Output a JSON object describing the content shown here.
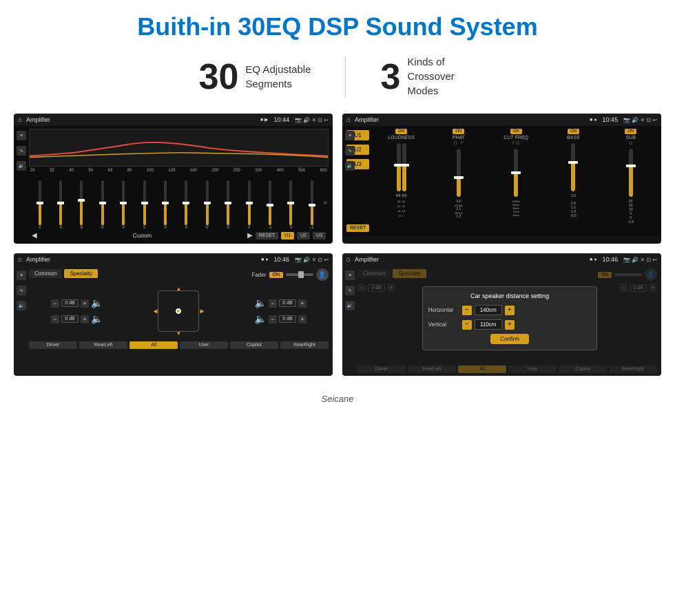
{
  "page": {
    "title": "Buith-in 30EQ DSP Sound System",
    "brand": "Seicane"
  },
  "stats": {
    "eq_number": "30",
    "eq_label_line1": "EQ Adjustable",
    "eq_label_line2": "Segments",
    "crossover_number": "3",
    "crossover_label_line1": "Kinds of",
    "crossover_label_line2": "Crossover Modes"
  },
  "screen1": {
    "title": "Amplifier",
    "time": "10:44",
    "eq_labels": [
      "25",
      "32",
      "40",
      "50",
      "63",
      "80",
      "100",
      "125",
      "160",
      "200",
      "250",
      "320",
      "400",
      "500",
      "630"
    ],
    "sliders": [
      {
        "val": "0",
        "fill": 50
      },
      {
        "val": "0",
        "fill": 50
      },
      {
        "val": "5",
        "fill": 55
      },
      {
        "val": "0",
        "fill": 50
      },
      {
        "val": "0",
        "fill": 50
      },
      {
        "val": "0",
        "fill": 50
      },
      {
        "val": "0",
        "fill": 50
      },
      {
        "val": "0",
        "fill": 50
      },
      {
        "val": "0",
        "fill": 50
      },
      {
        "val": "0",
        "fill": 50
      },
      {
        "val": "0",
        "fill": 50
      },
      {
        "val": "-1",
        "fill": 45
      },
      {
        "val": "0",
        "fill": 50
      },
      {
        "val": "-1",
        "fill": 45
      }
    ],
    "mode": "Custom",
    "buttons": [
      "RESET",
      "U1",
      "U2",
      "U3"
    ]
  },
  "screen2": {
    "title": "Amplifier",
    "time": "10:45",
    "u_buttons": [
      "U1",
      "U2",
      "U3"
    ],
    "reset_label": "RESET",
    "bands": [
      {
        "label": "LOUDNESS",
        "on": true
      },
      {
        "label": "PHAT",
        "on": true
      },
      {
        "label": "CUT FREQ",
        "on": true
      },
      {
        "label": "BASS",
        "on": true
      },
      {
        "label": "SUB",
        "on": true
      }
    ]
  },
  "screen3": {
    "title": "Amplifier",
    "time": "10:46",
    "tabs": [
      "Common",
      "Specialty"
    ],
    "active_tab": "Specialty",
    "fader_label": "Fader",
    "fader_on": "ON",
    "channels": {
      "top_left": "0 dB",
      "top_right": "0 dB",
      "bottom_left": "0 dB",
      "bottom_right": "0 dB"
    },
    "bottom_btns": [
      "Driver",
      "RearLeft",
      "All",
      "User",
      "Copilot",
      "RearRight"
    ]
  },
  "screen4": {
    "title": "Amplifier",
    "time": "10:46",
    "tabs": [
      "Common",
      "Specialty"
    ],
    "active_tab": "Specialty",
    "modal": {
      "title": "Car speaker distance setting",
      "horizontal_label": "Horizontal",
      "horizontal_val": "140cm",
      "vertical_label": "Vertical",
      "vertical_val": "110cm",
      "confirm_label": "Confirm",
      "side_label1": "0 dB",
      "side_label2": "0 dB"
    },
    "bottom_btns": [
      "Driver",
      "RearLeft",
      "All",
      "User",
      "Copilot",
      "RearRight"
    ]
  },
  "icons": {
    "home": "⌂",
    "back": "↩",
    "camera": "📷",
    "volume": "🔊",
    "close": "✕",
    "minimize": "⊡",
    "location": "📍",
    "prev": "◀",
    "next": "▶",
    "up": "▲",
    "down": "▼",
    "left": "◀",
    "right": "▶",
    "minus": "−",
    "plus": "+"
  }
}
